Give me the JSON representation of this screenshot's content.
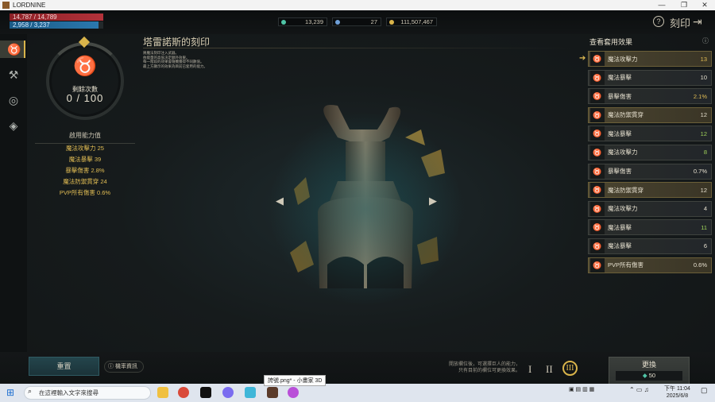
{
  "window": {
    "title": "LORDNINE",
    "minimize": "—",
    "restore": "❐",
    "close": "✕"
  },
  "status": {
    "hp": "14,787 / 14,789",
    "mp": "2,958 / 3,237"
  },
  "currencies": [
    {
      "icon": "crystal-icon",
      "value": "13,239",
      "color": "#4fc4a6"
    },
    {
      "icon": "ticket-icon",
      "value": "27",
      "color": "#6fa0d8"
    },
    {
      "icon": "coin-icon",
      "value": "111,507,467",
      "color": "#d9b44a"
    }
  ],
  "header": {
    "help": "?",
    "title": "刻印",
    "exit_icon": "exit-icon"
  },
  "sidebar": [
    "bull-head-icon",
    "hammer-icon",
    "orb-icon",
    "gem-cube-icon"
  ],
  "left": {
    "remaining_label": "剩餘次數",
    "remaining_value": "0 / 100",
    "abilities_title": "啟用能力值",
    "abilities": [
      "魔法攻擊力 25",
      "魔法暴擊 39",
      "暴擊傷害 2.8%",
      "魔法防禦貫穿 24",
      "PVP所有傷害 0.6%"
    ]
  },
  "main": {
    "title": "塔雷諾斯的刻印",
    "description": "將魔法刻印注入武器。\n依能量的高低決定額外效果。\n每一階段的效果會隨機獲得不同數值。\n最上方顯示的效果為目前已套用的能力。"
  },
  "right": {
    "title": "查看套用效果",
    "info": "ⓘ",
    "items": [
      {
        "name": "魔法攻擊力",
        "value": "13",
        "tone": "gold",
        "hl": true
      },
      {
        "name": "魔法暴擊",
        "value": "10",
        "tone": "white",
        "hl": false
      },
      {
        "name": "暴擊傷害",
        "value": "2.1%",
        "tone": "gold",
        "hl": false
      },
      {
        "name": "魔法防禦貫穿",
        "value": "12",
        "tone": "white",
        "hl": true
      },
      {
        "name": "魔法暴擊",
        "value": "12",
        "tone": "green",
        "hl": false
      },
      {
        "name": "魔法攻擊力",
        "value": "8",
        "tone": "green",
        "hl": false
      },
      {
        "name": "暴擊傷害",
        "value": "0.7%",
        "tone": "white",
        "hl": false
      },
      {
        "name": "魔法防禦貫穿",
        "value": "12",
        "tone": "white",
        "hl": true
      },
      {
        "name": "魔法攻擊力",
        "value": "4",
        "tone": "white",
        "hl": false
      },
      {
        "name": "魔法暴擊",
        "value": "11",
        "tone": "green",
        "hl": false
      },
      {
        "name": "魔法暴擊",
        "value": "6",
        "tone": "white",
        "hl": false
      },
      {
        "name": "PVP所有傷害",
        "value": "0.6%",
        "tone": "white",
        "hl": true
      }
    ]
  },
  "bottom": {
    "reset": "重置",
    "probability": "ⓘ 機率資訊",
    "hint1": "開放欄位後，可選擇巨人的能力，",
    "hint2": "只有目前的欄位可更換效果。",
    "tiers": [
      "I",
      "II",
      "III"
    ],
    "change_label": "更換",
    "change_cost": "50"
  },
  "taskbar": {
    "search_placeholder": "在這裡輸入文字來搜尋",
    "tooltip": "誇號.png* - 小畫家 3D",
    "time": "下午 11:04",
    "date": "2025/6/8"
  }
}
